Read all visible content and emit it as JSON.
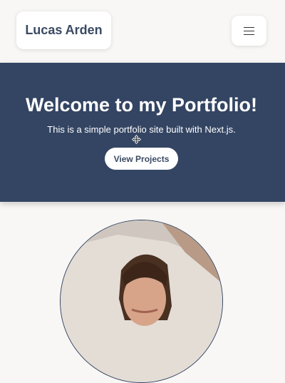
{
  "header": {
    "brand": "Lucas Arden",
    "menu_icon": "hamburger-menu-icon"
  },
  "hero": {
    "title": "Welcome to my Portfolio!",
    "subtitle": "This is a simple portfolio site built with Next.js.",
    "cta_label": "View Projects"
  },
  "profile": {
    "photo": "profile-photo"
  },
  "colors": {
    "hero_background": "#344563",
    "page_background": "#f8f7f5",
    "brand_text": "#3a4a63"
  }
}
